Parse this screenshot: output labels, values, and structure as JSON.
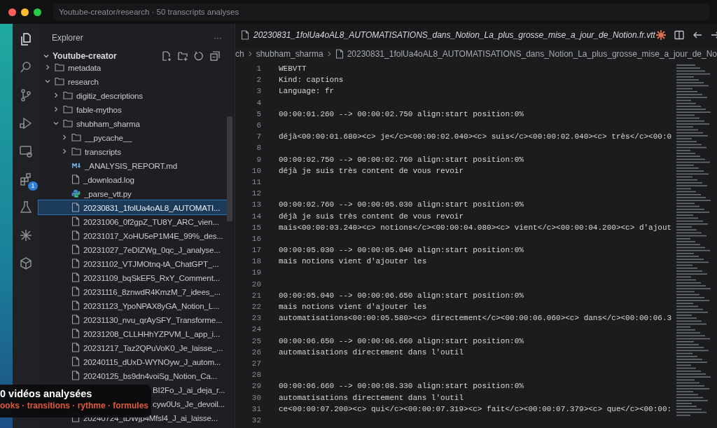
{
  "window": {
    "title": "Youtube-creator/research · 50 transcripts analyses"
  },
  "activity_bar": [
    {
      "kind": "files",
      "selected": true
    },
    {
      "kind": "search",
      "selected": false
    },
    {
      "kind": "git",
      "selected": false
    },
    {
      "kind": "run",
      "selected": false
    },
    {
      "kind": "remote",
      "selected": false
    },
    {
      "kind": "extensions",
      "selected": false,
      "badge": "1"
    },
    {
      "kind": "flask",
      "selected": false
    },
    {
      "kind": "spark",
      "selected": false
    },
    {
      "kind": "box",
      "selected": false
    }
  ],
  "explorer": {
    "title": "Explorer",
    "more": "···",
    "root": "Youtube-creator",
    "tree": [
      {
        "name": "metadata",
        "kind": "folder",
        "expanded": false,
        "selected": false
      },
      {
        "name": "research",
        "kind": "folder",
        "expanded": true,
        "selected": false,
        "children": [
          {
            "name": "digitiz_descriptions",
            "kind": "folder",
            "expanded": false,
            "selected": false
          },
          {
            "name": "fable-mythos",
            "kind": "folder",
            "expanded": false,
            "selected": false
          },
          {
            "name": "shubham_sharma",
            "kind": "folder",
            "expanded": true,
            "selected": false,
            "children": [
              {
                "name": "__pycache__",
                "kind": "folder",
                "expanded": false,
                "selected": false
              },
              {
                "name": "transcripts",
                "kind": "folder",
                "expanded": false,
                "selected": false
              },
              {
                "name": "_ANALYSIS_REPORT.md",
                "kind": "md",
                "selected": false
              },
              {
                "name": "_download.log",
                "kind": "file",
                "selected": false
              },
              {
                "name": "_parse_vtt.py",
                "kind": "py",
                "selected": false
              },
              {
                "name": "20230831_1folUa4oAL8_AUTOMATI...",
                "kind": "file",
                "selected": true
              },
              {
                "name": "20231006_0f2gpZ_TU8Y_ARC_vien...",
                "kind": "file",
                "selected": false
              },
              {
                "name": "20231017_XoHU5eP1M4E_99%_des...",
                "kind": "file",
                "selected": false
              },
              {
                "name": "20231027_7eDIZWg_0qc_J_analyse...",
                "kind": "file",
                "selected": false
              },
              {
                "name": "20231102_VTJMOtnq-tA_ChatGPT_...",
                "kind": "file",
                "selected": false
              },
              {
                "name": "20231109_bqSkEF5_RxY_Comment...",
                "kind": "file",
                "selected": false
              },
              {
                "name": "20231116_8znwdR4KmzM_7_idees_...",
                "kind": "file",
                "selected": false
              },
              {
                "name": "20231123_YpoNPAX8yGA_Notion_L...",
                "kind": "file",
                "selected": false
              },
              {
                "name": "20231130_nvu_qrAySFY_Transforme...",
                "kind": "file",
                "selected": false
              },
              {
                "name": "20231208_CLLHHhYZPVM_L_app_i...",
                "kind": "file",
                "selected": false
              },
              {
                "name": "20231217_Taz2QPuVoK0_Je_laisse_...",
                "kind": "file",
                "selected": false
              },
              {
                "name": "20240115_dUxD-WYNOyw_J_autom...",
                "kind": "file",
                "selected": false
              },
              {
                "name": "20240125_bs9dn4voiSg_Notion_Ca...",
                "kind": "file",
                "selected": false
              },
              {
                "name": "BI2Fo_J_ai_deja_r...",
                "kind": "partial",
                "selected": false
              },
              {
                "name": "cyw0Us_Je_devoil...",
                "kind": "partial",
                "selected": false
              },
              {
                "name": "20240724_tDWjp4Mfsl4_J_ai_laisse...",
                "kind": "file",
                "selected": false
              }
            ]
          }
        ]
      }
    ]
  },
  "editor": {
    "tab": "20230831_1folUa4oAL8_AUTOMATISATIONS_dans_Notion_La_plus_grosse_mise_a_jour_de_Notion.fr.vtt",
    "breadcrumb": [
      "ch",
      "shubham_sharma",
      "20230831_1folUa4oAL8_AUTOMATISATIONS_dans_Notion_La_plus_grosse_mise_a_jour_de_No"
    ],
    "lines": [
      {
        "n": "1",
        "text": "WEBVTT"
      },
      {
        "n": "2",
        "text": "Kind: captions"
      },
      {
        "n": "3",
        "text": "Language: fr"
      },
      {
        "n": "4"
      },
      {
        "n": "5",
        "text": "00:00:01.260 --> 00:00:02.750 align:start position:0%"
      },
      {
        "n": "6"
      },
      {
        "n": "7",
        "text": "déjà<00:00:01.680><c> je</c><00:00:02.040><c> suis</c><00:00:02.040><c> très</c><00:0"
      },
      {
        "n": "8"
      },
      {
        "n": "9",
        "text": "00:00:02.750 --> 00:00:02.760 align:start position:0%"
      },
      {
        "n": "10",
        "text": "déjà je suis très content de vous revoir"
      },
      {
        "n": "11"
      },
      {
        "n": "12"
      },
      {
        "n": "13",
        "text": "00:00:02.760 --> 00:00:05.030 align:start position:0%"
      },
      {
        "n": "14",
        "text": "déjà je suis très content de vous revoir"
      },
      {
        "n": "15",
        "text": "mais<00:00:03.240><c> notions</c><00:00:04.080><c> vient</c><00:00:04.200><c> d'ajout"
      },
      {
        "n": "16"
      },
      {
        "n": "17",
        "text": "00:00:05.030 --> 00:00:05.040 align:start position:0%"
      },
      {
        "n": "18",
        "text": "mais notions vient d'ajouter les"
      },
      {
        "n": "19"
      },
      {
        "n": "20"
      },
      {
        "n": "21",
        "text": "00:00:05.040 --> 00:00:06.650 align:start position:0%"
      },
      {
        "n": "22",
        "text": "mais notions vient d'ajouter les"
      },
      {
        "n": "23",
        "text": "automatisations<00:00:05.580><c> directement</c><00:00:06.060><c> dans</c><00:00:06.3"
      },
      {
        "n": "24"
      },
      {
        "n": "25",
        "text": "00:00:06.650 --> 00:00:06.660 align:start position:0%"
      },
      {
        "n": "26",
        "text": "automatisations directement dans l'outil"
      },
      {
        "n": "27"
      },
      {
        "n": "28"
      },
      {
        "n": "29",
        "text": "00:00:06.660 --> 00:00:08.330 align:start position:0%"
      },
      {
        "n": "30",
        "text": "automatisations directement dans l'outil"
      },
      {
        "n": "31",
        "text": "ce<00:00:07.200><c> qui</c><00:00:07.319><c> fait</c><00:00:07.379><c> que</c><00:00:"
      },
      {
        "n": "32"
      }
    ]
  },
  "overlay": {
    "title": "0 vidéos analysées",
    "subtitle": "ooks · transitions · rythme · formules"
  }
}
